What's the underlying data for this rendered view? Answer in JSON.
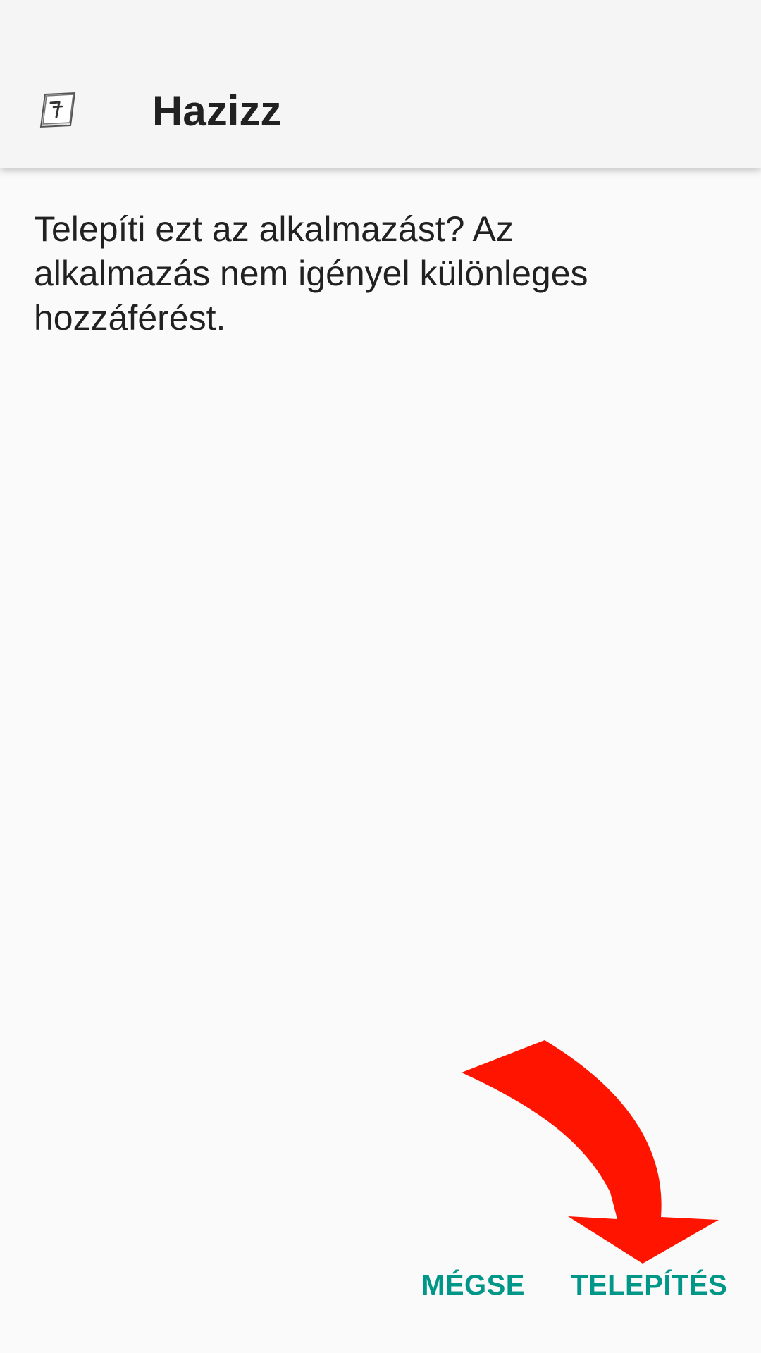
{
  "app_bar": {
    "app_name": "Hazizz",
    "icon": "notebook-app-icon"
  },
  "dialog": {
    "message": "Telepíti ezt az alkalmazást? Az alkalmazás nem igényel különleges hozzáférést."
  },
  "buttons": {
    "cancel_label": "MÉGSE",
    "install_label": "TELEPÍTÉS"
  },
  "colors": {
    "accent": "#009688",
    "annotation_arrow": "#ff1400",
    "app_bar_bg": "#f5f5f5",
    "page_bg": "#fafafa",
    "text": "#212121"
  },
  "annotation": {
    "icon": "red-curved-arrow-icon"
  }
}
